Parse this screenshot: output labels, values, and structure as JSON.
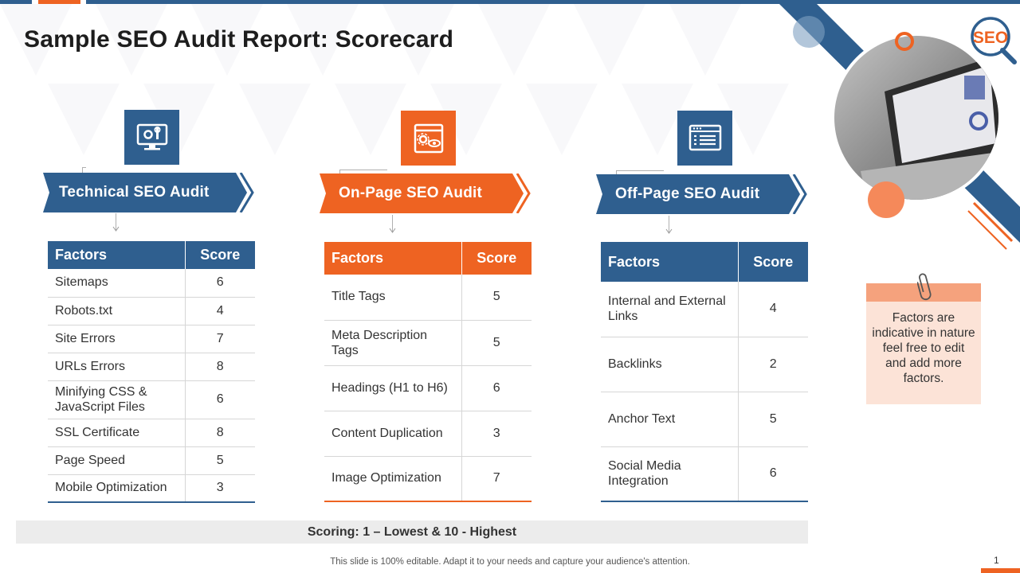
{
  "slide": {
    "title": "Sample SEO Audit Report: Scorecard",
    "page_number": "1",
    "footer": "This slide is 100% editable. Adapt it to your needs and capture your audience's attention.",
    "scoring": "Scoring: 1 – Lowest & 10 - Highest",
    "badge": "SEO"
  },
  "colors": {
    "blue": "#2f5f8f",
    "orange": "#ee6322",
    "note": "#fce3d7"
  },
  "technical": {
    "heading": "Technical SEO Audit",
    "icon": "monitor-settings-icon",
    "col_factors": "Factors",
    "col_score": "Score",
    "rows": [
      {
        "factor": "Sitemaps",
        "score": "6"
      },
      {
        "factor": "Robots.txt",
        "score": "4"
      },
      {
        "factor": "Site Errors",
        "score": "7"
      },
      {
        "factor": "URLs Errors",
        "score": "8"
      },
      {
        "factor": "Minifying CSS & JavaScript Files",
        "score": "6"
      },
      {
        "factor": "SSL Certificate",
        "score": "8"
      },
      {
        "factor": "Page Speed",
        "score": "5"
      },
      {
        "factor": "Mobile Optimization",
        "score": "3"
      }
    ]
  },
  "onpage": {
    "heading": "On-Page SEO Audit",
    "icon": "web-page-settings-icon",
    "col_factors": "Factors",
    "col_score": "Score",
    "rows": [
      {
        "factor": "Title Tags",
        "score": "5"
      },
      {
        "factor": "Meta Description Tags",
        "score": "5"
      },
      {
        "factor": "Headings (H1 to H6)",
        "score": "6"
      },
      {
        "factor": "Content Duplication",
        "score": "3"
      },
      {
        "factor": "Image Optimization",
        "score": "7"
      }
    ]
  },
  "offpage": {
    "heading": "Off-Page SEO Audit",
    "icon": "browser-list-icon",
    "col_factors": "Factors",
    "col_score": "Score",
    "rows": [
      {
        "factor": "Internal  and External Links",
        "score": "4"
      },
      {
        "factor": "Backlinks",
        "score": "2"
      },
      {
        "factor": "Anchor Text",
        "score": "5"
      },
      {
        "factor": "Social Media Integration",
        "score": "6"
      }
    ]
  },
  "note": {
    "text": "Factors are indicative in nature feel free to edit and add more factors.",
    "icon": "paperclip-icon"
  }
}
